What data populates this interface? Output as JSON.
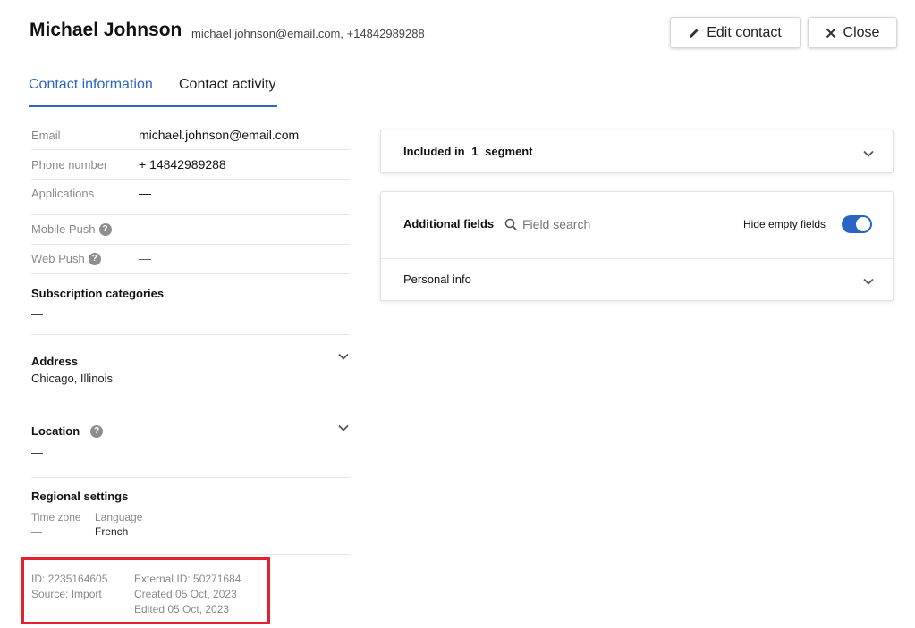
{
  "header": {
    "name": "Michael Johnson",
    "subtitle": "michael.johnson@email.com, +14842989288",
    "edit_label": "Edit contact",
    "close_label": "Close"
  },
  "tabs": [
    {
      "label": "Contact information",
      "active": true
    },
    {
      "label": "Contact activity",
      "active": false
    }
  ],
  "fields": {
    "email": {
      "label": "Email",
      "value": "michael.johnson@email.com"
    },
    "phone": {
      "label": "Phone number",
      "value": "+ 14842989288"
    },
    "applications": {
      "label": "Applications",
      "value": "—"
    },
    "mobile_push": {
      "label": "Mobile Push",
      "value": "—"
    },
    "web_push": {
      "label": "Web Push",
      "value": "—"
    }
  },
  "subscription": {
    "title": "Subscription categories",
    "value": "—"
  },
  "address": {
    "title": "Address",
    "value": "Chicago, Illinois"
  },
  "location": {
    "title": "Location",
    "value": "—"
  },
  "regional": {
    "title": "Regional settings",
    "timezone_label": "Time zone",
    "timezone_value": "—",
    "language_label": "Language",
    "language_value": "French"
  },
  "meta": {
    "id": "ID: 2235164605",
    "source": "Source:  Import",
    "external_id": "External ID: 50271684",
    "created": "Created 05 Oct, 2023",
    "edited": "Edited 05 Oct, 2023"
  },
  "segments": {
    "prefix": "Included in",
    "count": "1",
    "suffix": "segment"
  },
  "additional": {
    "title": "Additional fields",
    "search_placeholder": "Field search",
    "hide_empty_label": "Hide empty fields",
    "hide_empty_on": true,
    "group_label": "Personal info"
  },
  "colors": {
    "accent": "#2b65c4",
    "highlight_border": "#e2232f"
  }
}
